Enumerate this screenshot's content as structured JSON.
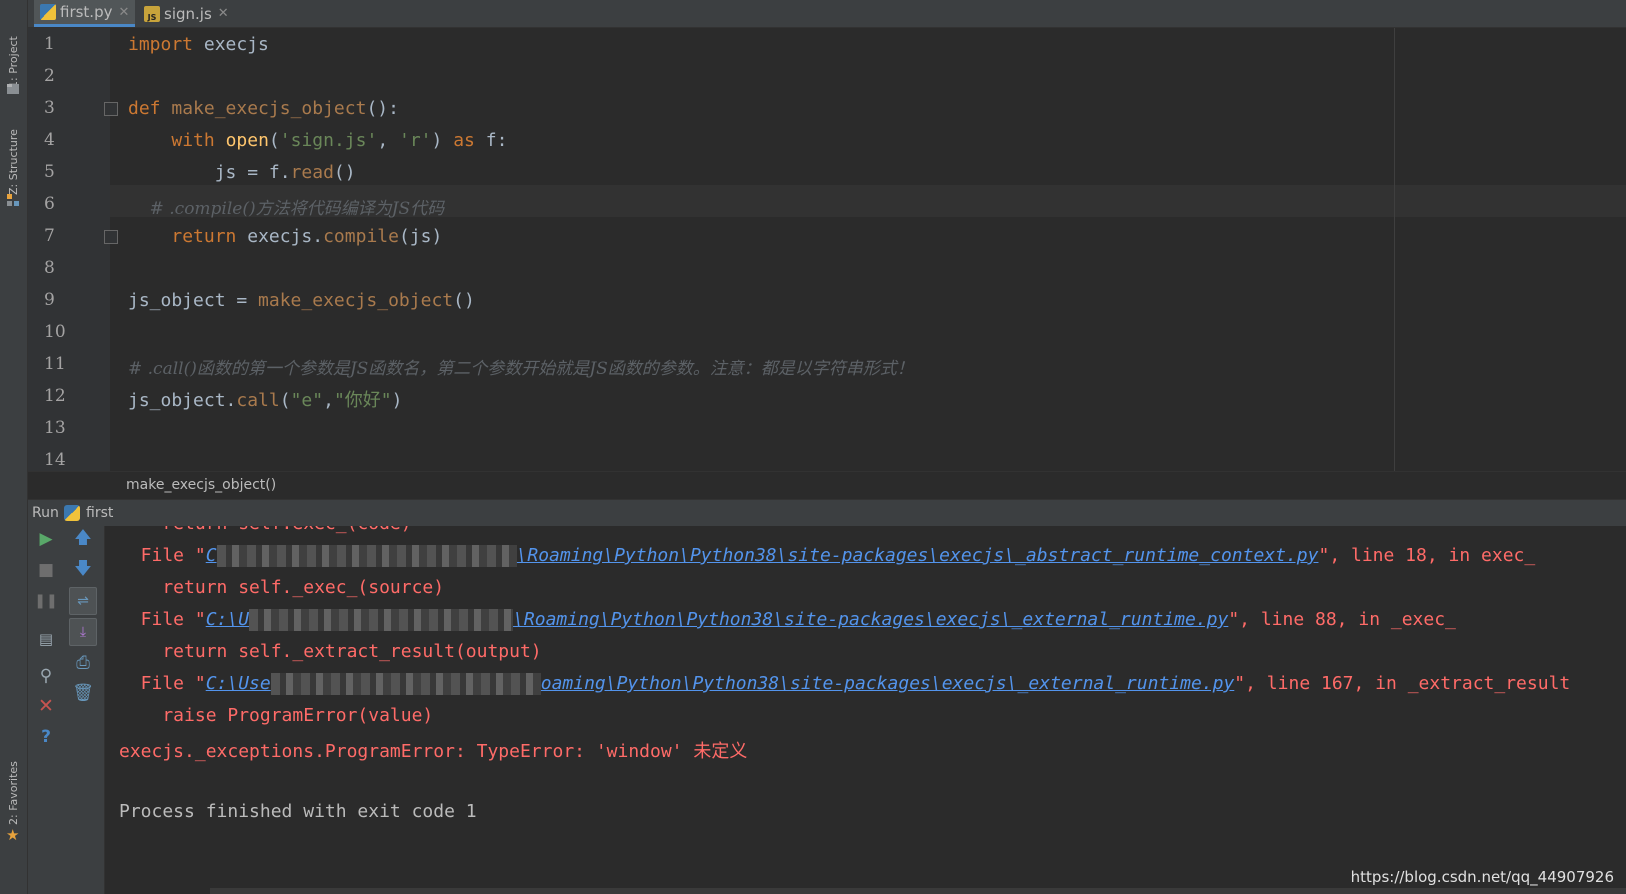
{
  "side_tabs": {
    "project": "1: Project",
    "structure": "Z: Structure",
    "favorites": "2: Favorites"
  },
  "tabs": [
    {
      "label": "first.py",
      "active": true,
      "icon": "python-file-icon"
    },
    {
      "label": "sign.js",
      "active": false,
      "icon": "js-file-icon"
    }
  ],
  "editor": {
    "line_numbers": [
      "1",
      "2",
      "3",
      "4",
      "5",
      "6",
      "7",
      "8",
      "9",
      "10",
      "11",
      "12",
      "13",
      "14"
    ],
    "current_line": 6
  },
  "breadcrumb": "make_execjs_object()",
  "run": {
    "label": "Run",
    "config": "first"
  },
  "console": {
    "l1": "    return self.exec_(code)",
    "l2_prefix": "  File \"",
    "l2_path_start": "C",
    "l2_path_end": "\\Roaming\\Python\\Python38\\site-packages\\execjs\\_abstract_runtime_context.py",
    "l2_suffix": "\", line 18, in exec_",
    "l3": "    return self._exec_(source)",
    "l4_prefix": "  File \"",
    "l4_path_start": "C:\\U",
    "l4_path_end": "\\Roaming\\Python\\Python38\\site-packages\\execjs\\_external_runtime.py",
    "l4_suffix": "\", line 88, in _exec_",
    "l5": "    return self._extract_result(output)",
    "l6_prefix": "  File \"",
    "l6_path_start": "C:\\Use",
    "l6_path_end": "oaming\\Python\\Python38\\site-packages\\execjs\\_external_runtime.py",
    "l6_suffix": "\", line 167, in _extract_result",
    "l7": "    raise ProgramError(value)",
    "l8": "execjs._exceptions.ProgramError: TypeError: 'window' 未定义",
    "l9": "Process finished with exit code 1"
  },
  "watermark": "https://blog.csdn.net/qq_44907926",
  "colors": {
    "background": "#2b2b2b",
    "keyword": "#cc7832",
    "string": "#6a8759",
    "error": "#ff6b68",
    "link": "#5394ec"
  }
}
